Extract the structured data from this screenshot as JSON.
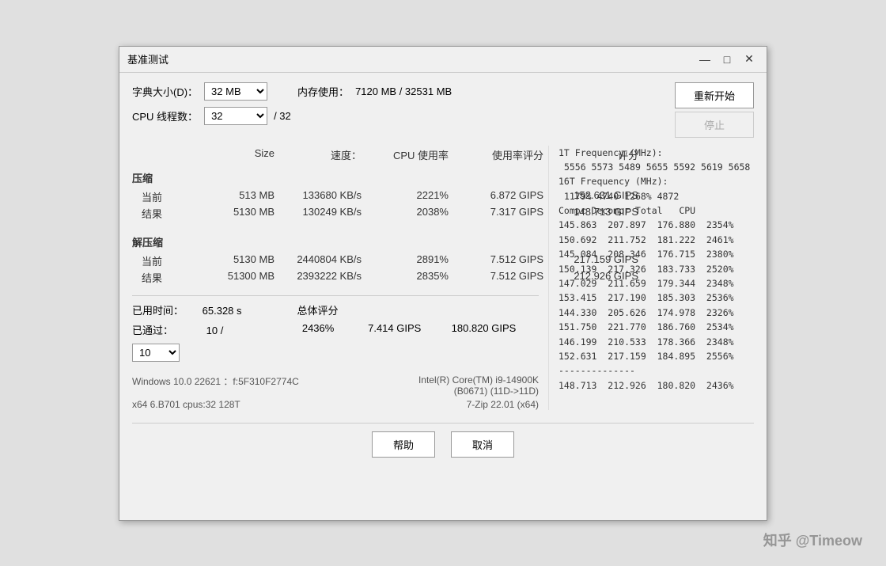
{
  "window": {
    "title": "基准测试",
    "minimize": "—",
    "restore": "□",
    "close": "✕"
  },
  "form": {
    "dict_size_label": "字典大小(D)：",
    "dict_size_value": "32 MB",
    "mem_label": "内存使用：",
    "mem_value": "7120 MB / 32531 MB",
    "cpu_threads_label": "CPU 线程数：",
    "cpu_threads_value": "32",
    "cpu_threads_max": "/ 32",
    "btn_start": "重新开始",
    "btn_stop": "停止"
  },
  "table": {
    "headers": [
      "",
      "Size",
      "速度：",
      "CPU 使用率",
      "使用率评分",
      "评分"
    ],
    "compress_title": "压缩",
    "decompress_title": "解压缩",
    "compress_rows": [
      {
        "label": "当前",
        "size": "513 MB",
        "speed": "133680 KB/s",
        "cpu": "2221%",
        "rating1": "6.872 GIPS",
        "rating2": "152.631 GIPS"
      },
      {
        "label": "结果",
        "size": "5130 MB",
        "speed": "130249 KB/s",
        "cpu": "2038%",
        "rating1": "7.317 GIPS",
        "rating2": "148.713 GIPS"
      }
    ],
    "decompress_rows": [
      {
        "label": "当前",
        "size": "5130 MB",
        "speed": "2440804 KB/s",
        "cpu": "2891%",
        "rating1": "7.512 GIPS",
        "rating2": "217.159 GIPS"
      },
      {
        "label": "结果",
        "size": "51300 MB",
        "speed": "2393222 KB/s",
        "cpu": "2835%",
        "rating1": "7.512 GIPS",
        "rating2": "212.926 GIPS"
      }
    ]
  },
  "summary": {
    "elapsed_label": "已用时间：",
    "elapsed_value": "65.328 s",
    "passed_label": "已通过：",
    "passed_value": "10 /",
    "total_label": "总体评分",
    "cpu_rating": "2436%",
    "rating1": "7.414 GIPS",
    "rating2": "180.820 GIPS",
    "passes_select": "10"
  },
  "right_panel": {
    "content": "1T Frequency (MHz):\n 5556 5573 5489 5655 5592 5619 5658\n16T Frequency (MHz):\n 1179% 4740 1268% 4872\nCompr Decompr Total   CPU\n145.863  207.897  176.880  2354%\n150.692  211.752  181.222  2461%\n145.084  208.346  176.715  2380%\n150.139  217.326  183.733  2520%\n147.029  211.659  179.344  2348%\n153.415  217.190  185.303  2536%\n144.330  205.626  174.978  2326%\n151.750  221.770  186.760  2534%\n146.199  210.533  178.366  2348%\n152.631  217.159  184.895  2556%\n--------------\n148.713  212.926  180.820  2436%"
  },
  "info": {
    "cpu": "Intel(R) Core(TM) i9-14900K",
    "cpu_detail": "(B0671) (11D->11D)",
    "os": "Windows 10.0 22621 ：f:5F310F2774C",
    "zip": "7-Zip 22.01 (x64)",
    "arch": "x64 6.B701 cpus:32 128T"
  },
  "footer": {
    "help_btn": "帮助",
    "cancel_btn": "取消",
    "watermark": "知乎 @Timeow"
  }
}
